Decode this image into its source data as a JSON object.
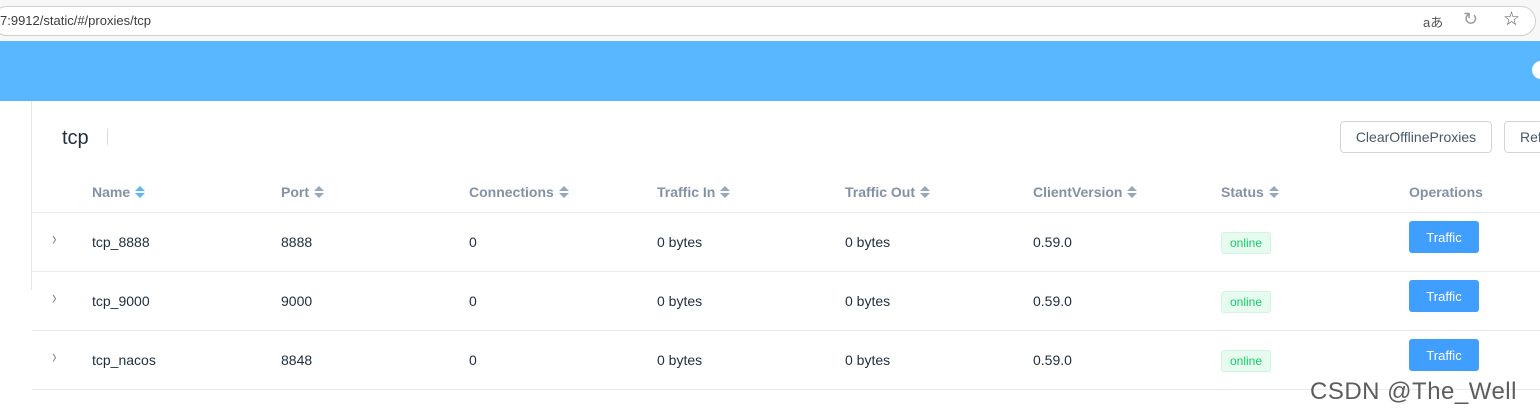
{
  "browser": {
    "url": "7:9912/static/#/proxies/tcp",
    "read_aloud_icon": "aあ",
    "refresh_icon": "↻",
    "favorite_icon": "☆"
  },
  "page": {
    "title": "tcp",
    "clear_button": "ClearOfflineProxies",
    "refresh_button": "Refresh"
  },
  "table": {
    "columns": [
      "Name",
      "Port",
      "Connections",
      "Traffic In",
      "Traffic Out",
      "ClientVersion",
      "Status",
      "Operations"
    ],
    "rows": [
      {
        "name": "tcp_8888",
        "port": "8888",
        "connections": "0",
        "traffic_in": "0 bytes",
        "traffic_out": "0 bytes",
        "client_version": "0.59.0",
        "status": "online",
        "operation": "Traffic"
      },
      {
        "name": "tcp_9000",
        "port": "9000",
        "connections": "0",
        "traffic_in": "0 bytes",
        "traffic_out": "0 bytes",
        "client_version": "0.59.0",
        "status": "online",
        "operation": "Traffic"
      },
      {
        "name": "tcp_nacos",
        "port": "8848",
        "connections": "0",
        "traffic_in": "0 bytes",
        "traffic_out": "0 bytes",
        "client_version": "0.59.0",
        "status": "online",
        "operation": "Traffic"
      }
    ]
  },
  "watermark": "CSDN @The_Well",
  "colors": {
    "header": "#58b7ff",
    "primary_button": "#409eff",
    "online_text": "#13ce66",
    "online_bg": "#e7faf0"
  }
}
